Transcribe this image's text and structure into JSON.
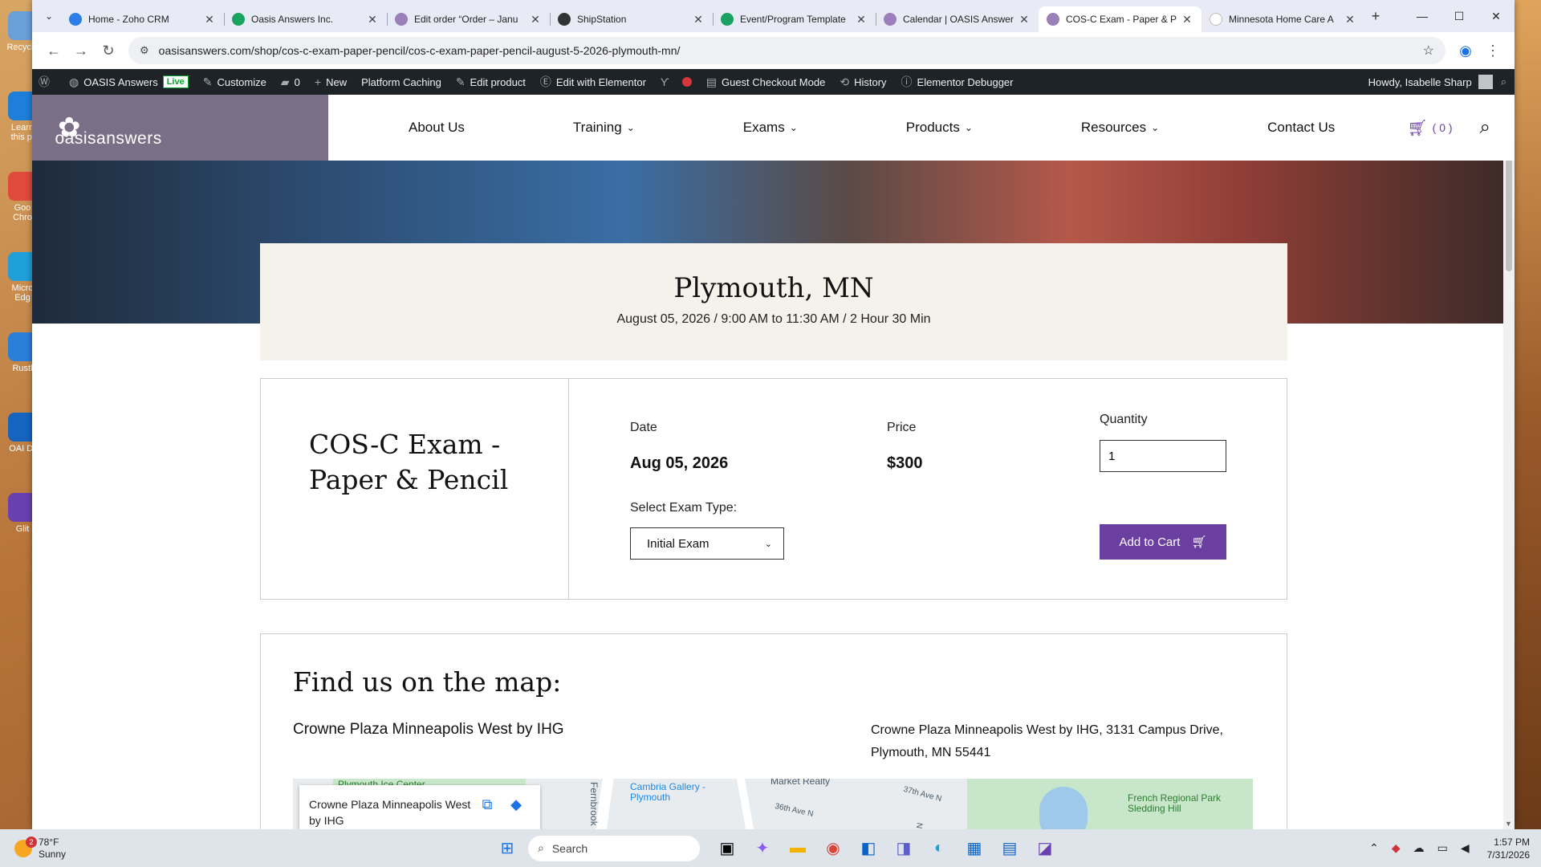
{
  "desktop": {
    "icons": [
      {
        "label": "Recycle",
        "color": "#6aa0d8"
      },
      {
        "label": "Learn this pi",
        "color": "#1e7fd8"
      },
      {
        "label": "Goo Chro",
        "color": "#e04a3a"
      },
      {
        "label": "Micro Edg",
        "color": "#1fa0d8"
      },
      {
        "label": "Rustl",
        "color": "#2a7fd8"
      },
      {
        "label": "OAI Dr",
        "color": "#1565c0"
      },
      {
        "label": "Glit",
        "color": "#6a3fb0"
      }
    ]
  },
  "browser": {
    "tabs": [
      {
        "title": "Home - Zoho CRM",
        "color": "#2b7de9",
        "active": false
      },
      {
        "title": "Oasis Answers Inc.",
        "color": "#1aa260",
        "active": false
      },
      {
        "title": "Edit order “Order – Janu",
        "color": "#9a7fb8",
        "active": false
      },
      {
        "title": "ShipStation",
        "color": "#333333",
        "active": false
      },
      {
        "title": "Event/Program Template",
        "color": "#1aa260",
        "active": false
      },
      {
        "title": "Calendar | OASIS Answer",
        "color": "#9a7fb8",
        "active": false
      },
      {
        "title": "COS-C Exam - Paper & P",
        "color": "#9a7fb8",
        "active": true
      },
      {
        "title": "Minnesota Home Care A",
        "color": "#ffffff",
        "active": false
      }
    ],
    "url": "oasisanswers.com/shop/cos-c-exam-paper-pencil/cos-c-exam-paper-pencil-august-5-2026-plymouth-mn/"
  },
  "wpbar": {
    "items": [
      {
        "label": "OASIS Answers"
      },
      {
        "label": "Customize"
      },
      {
        "label": "0"
      },
      {
        "label": "New"
      },
      {
        "label": "Platform Caching"
      },
      {
        "label": "Edit product"
      },
      {
        "label": "Edit with Elementor"
      },
      {
        "label": "Guest Checkout Mode"
      },
      {
        "label": "History"
      },
      {
        "label": "Elementor Debugger"
      }
    ],
    "live_badge": "Live",
    "greeting": "Howdy, Isabelle Sharp"
  },
  "site": {
    "logo_text": "oasisanswers",
    "nav": [
      {
        "label": "About Us",
        "dropdown": false
      },
      {
        "label": "Training",
        "dropdown": true
      },
      {
        "label": "Exams",
        "dropdown": true
      },
      {
        "label": "Products",
        "dropdown": true
      },
      {
        "label": "Resources",
        "dropdown": true
      },
      {
        "label": "Contact Us",
        "dropdown": false
      }
    ],
    "cart_count": "( 0 )"
  },
  "event": {
    "location": "Plymouth, MN",
    "datetime": "August 05, 2026 / 9:00 AM to 11:30 AM / 2 Hour 30 Min"
  },
  "product": {
    "name": "COS-C Exam - Paper & Pencil",
    "date_label": "Date",
    "date_value": "Aug 05, 2026",
    "price_label": "Price",
    "price_value": "$300",
    "quantity_label": "Quantity",
    "quantity_value": "1",
    "exam_type_label": "Select Exam Type:",
    "exam_type_value": "Initial Exam",
    "add_to_cart": "Add to Cart"
  },
  "map_section": {
    "heading": "Find us on the map:",
    "venue": "Crowne Plaza Minneapolis West by IHG",
    "address": "Crowne Plaza Minneapolis West by IHG, 3131 Campus Drive, Plymouth, MN 55441",
    "card_name": "Crowne Plaza Minneapolis West by IHG",
    "map_labels": {
      "ice_center": "Plymouth Ice Center",
      "gallery": "Cambria Gallery - Plymouth",
      "realty": "Market Realty",
      "ave37": "37th Ave N",
      "ave36": "36th Ave N",
      "fernbrook": "Fernbrook",
      "french": "French Regional Park Sledding Hill",
      "lane": "Ln N"
    }
  },
  "taskbar": {
    "temp": "78°F",
    "condition": "Sunny",
    "weather_badge": "2",
    "search_placeholder": "Search",
    "time": "1:57 PM",
    "date": "7/31/2026"
  }
}
